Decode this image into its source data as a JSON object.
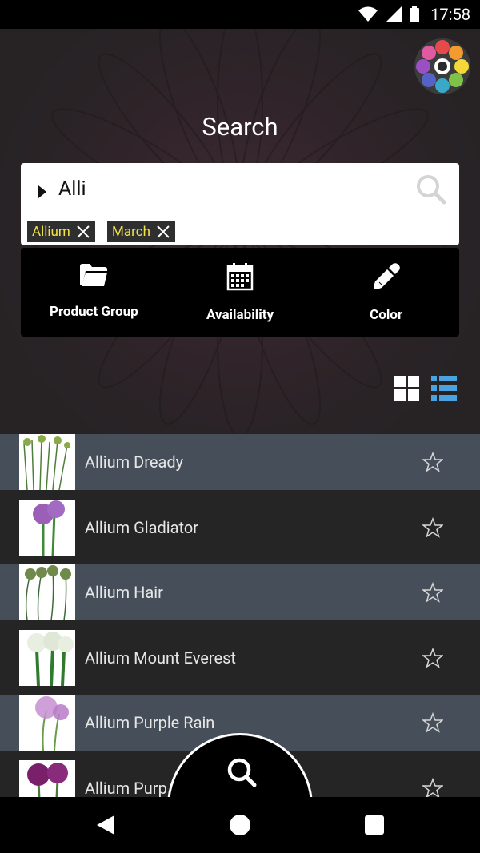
{
  "status_bar": {
    "time": "17:58"
  },
  "header": {
    "title": "Search"
  },
  "search": {
    "query": "Alli",
    "chips": [
      {
        "label": "Allium"
      },
      {
        "label": "March"
      }
    ]
  },
  "filters": [
    {
      "label": "Product Group",
      "icon": "folder-icon"
    },
    {
      "label": "Availability",
      "icon": "calendar-icon"
    },
    {
      "label": "Color",
      "icon": "color-picker-icon"
    }
  ],
  "view_modes": {
    "selected": "list",
    "accent": "#4aa3df"
  },
  "results": [
    {
      "name": "Allium Dready"
    },
    {
      "name": "Allium Gladiator"
    },
    {
      "name": "Allium Hair"
    },
    {
      "name": "Allium Mount Everest"
    },
    {
      "name": "Allium Purple Rain"
    },
    {
      "name": "Allium Purp"
    }
  ],
  "colors": {
    "row_light": "#464f59",
    "row_dark": "#252525",
    "chip_text": "#f2e24a"
  }
}
